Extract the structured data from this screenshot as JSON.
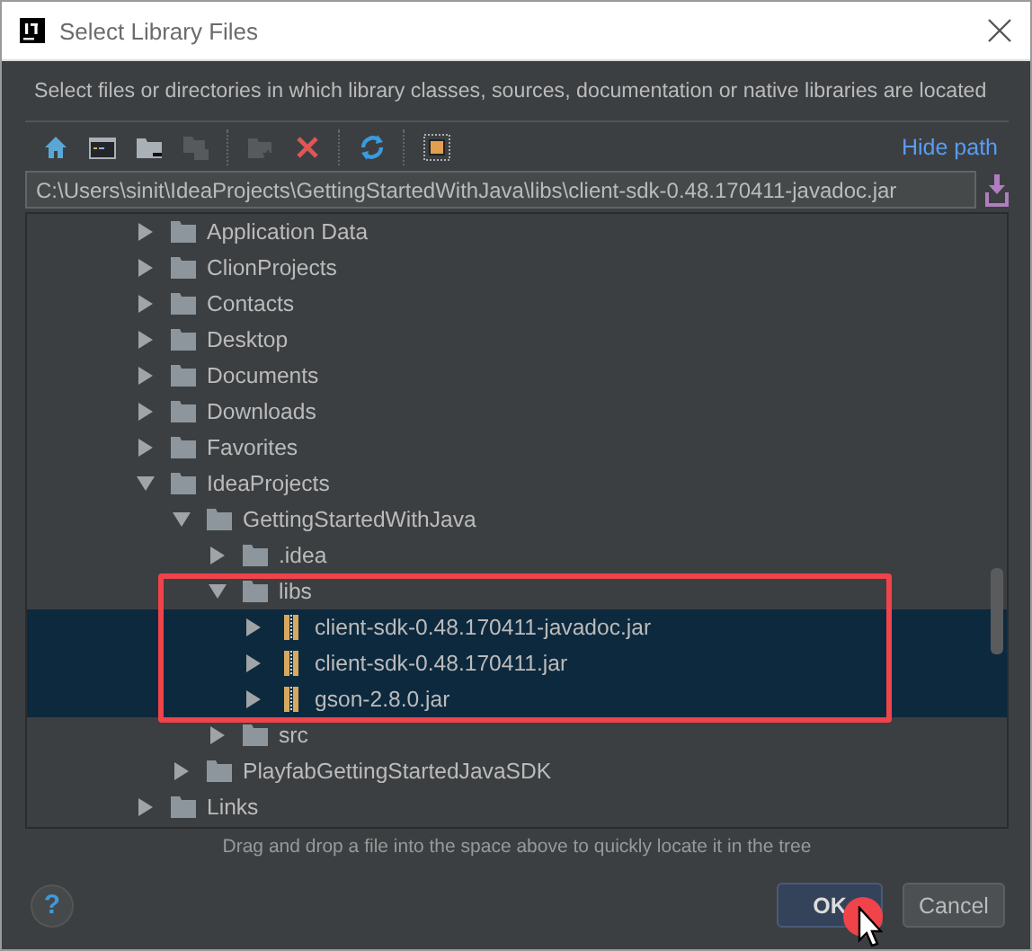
{
  "window": {
    "title": "Select Library Files"
  },
  "description": "Select files or directories in which library classes, sources, documentation or native libraries are located",
  "toolbar": [
    {
      "kind": "home",
      "disabled": false
    },
    {
      "kind": "window",
      "disabled": false
    },
    {
      "kind": "folder",
      "disabled": false
    },
    {
      "kind": "folders",
      "disabled": true
    },
    {
      "kind": "new-folder",
      "disabled": true
    },
    {
      "kind": "delete",
      "disabled": false
    },
    {
      "kind": "refresh",
      "disabled": false
    },
    {
      "kind": "frame",
      "disabled": false
    }
  ],
  "hide_path_link": "Hide path",
  "path_field": {
    "value": "C:\\Users\\sinit\\IdeaProjects\\GettingStartedWithJava\\libs\\client-sdk-0.48.170411-javadoc.jar"
  },
  "tree": [
    {
      "label": "Application Data",
      "kind": "folder",
      "expanded": false,
      "selected": false
    },
    {
      "label": "ClionProjects",
      "kind": "folder",
      "expanded": false,
      "selected": false
    },
    {
      "label": "Contacts",
      "kind": "folder",
      "expanded": false,
      "selected": false
    },
    {
      "label": "Desktop",
      "kind": "folder",
      "expanded": false,
      "selected": false
    },
    {
      "label": "Documents",
      "kind": "folder",
      "expanded": false,
      "selected": false
    },
    {
      "label": "Downloads",
      "kind": "folder",
      "expanded": false,
      "selected": false
    },
    {
      "label": "Favorites",
      "kind": "folder",
      "expanded": false,
      "selected": false
    },
    {
      "label": "IdeaProjects",
      "kind": "folder",
      "expanded": true,
      "selected": false,
      "children": [
        {
          "label": "GettingStartedWithJava",
          "kind": "folder",
          "expanded": true,
          "selected": false,
          "children": [
            {
              "label": ".idea",
              "kind": "folder",
              "expanded": false,
              "selected": false
            },
            {
              "label": "libs",
              "kind": "folder",
              "expanded": true,
              "selected": false,
              "children": [
                {
                  "label": "client-sdk-0.48.170411-javadoc.jar",
                  "kind": "jar",
                  "expanded": false,
                  "selected": true
                },
                {
                  "label": "client-sdk-0.48.170411.jar",
                  "kind": "jar",
                  "expanded": false,
                  "selected": true
                },
                {
                  "label": "gson-2.8.0.jar",
                  "kind": "jar",
                  "expanded": false,
                  "selected": true
                }
              ]
            },
            {
              "label": "src",
              "kind": "folder",
              "expanded": false,
              "selected": false
            }
          ]
        },
        {
          "label": "PlayfabGettingStartedJavaSDK",
          "kind": "folder",
          "expanded": false,
          "selected": false
        }
      ]
    },
    {
      "label": "Links",
      "kind": "folder",
      "expanded": false,
      "selected": false
    }
  ],
  "hint": "Drag and drop a file into the space above to quickly locate it in the tree",
  "help_button": "?",
  "buttons": [
    {
      "label": "OK",
      "default": true
    },
    {
      "label": "Cancel",
      "default": false
    }
  ]
}
